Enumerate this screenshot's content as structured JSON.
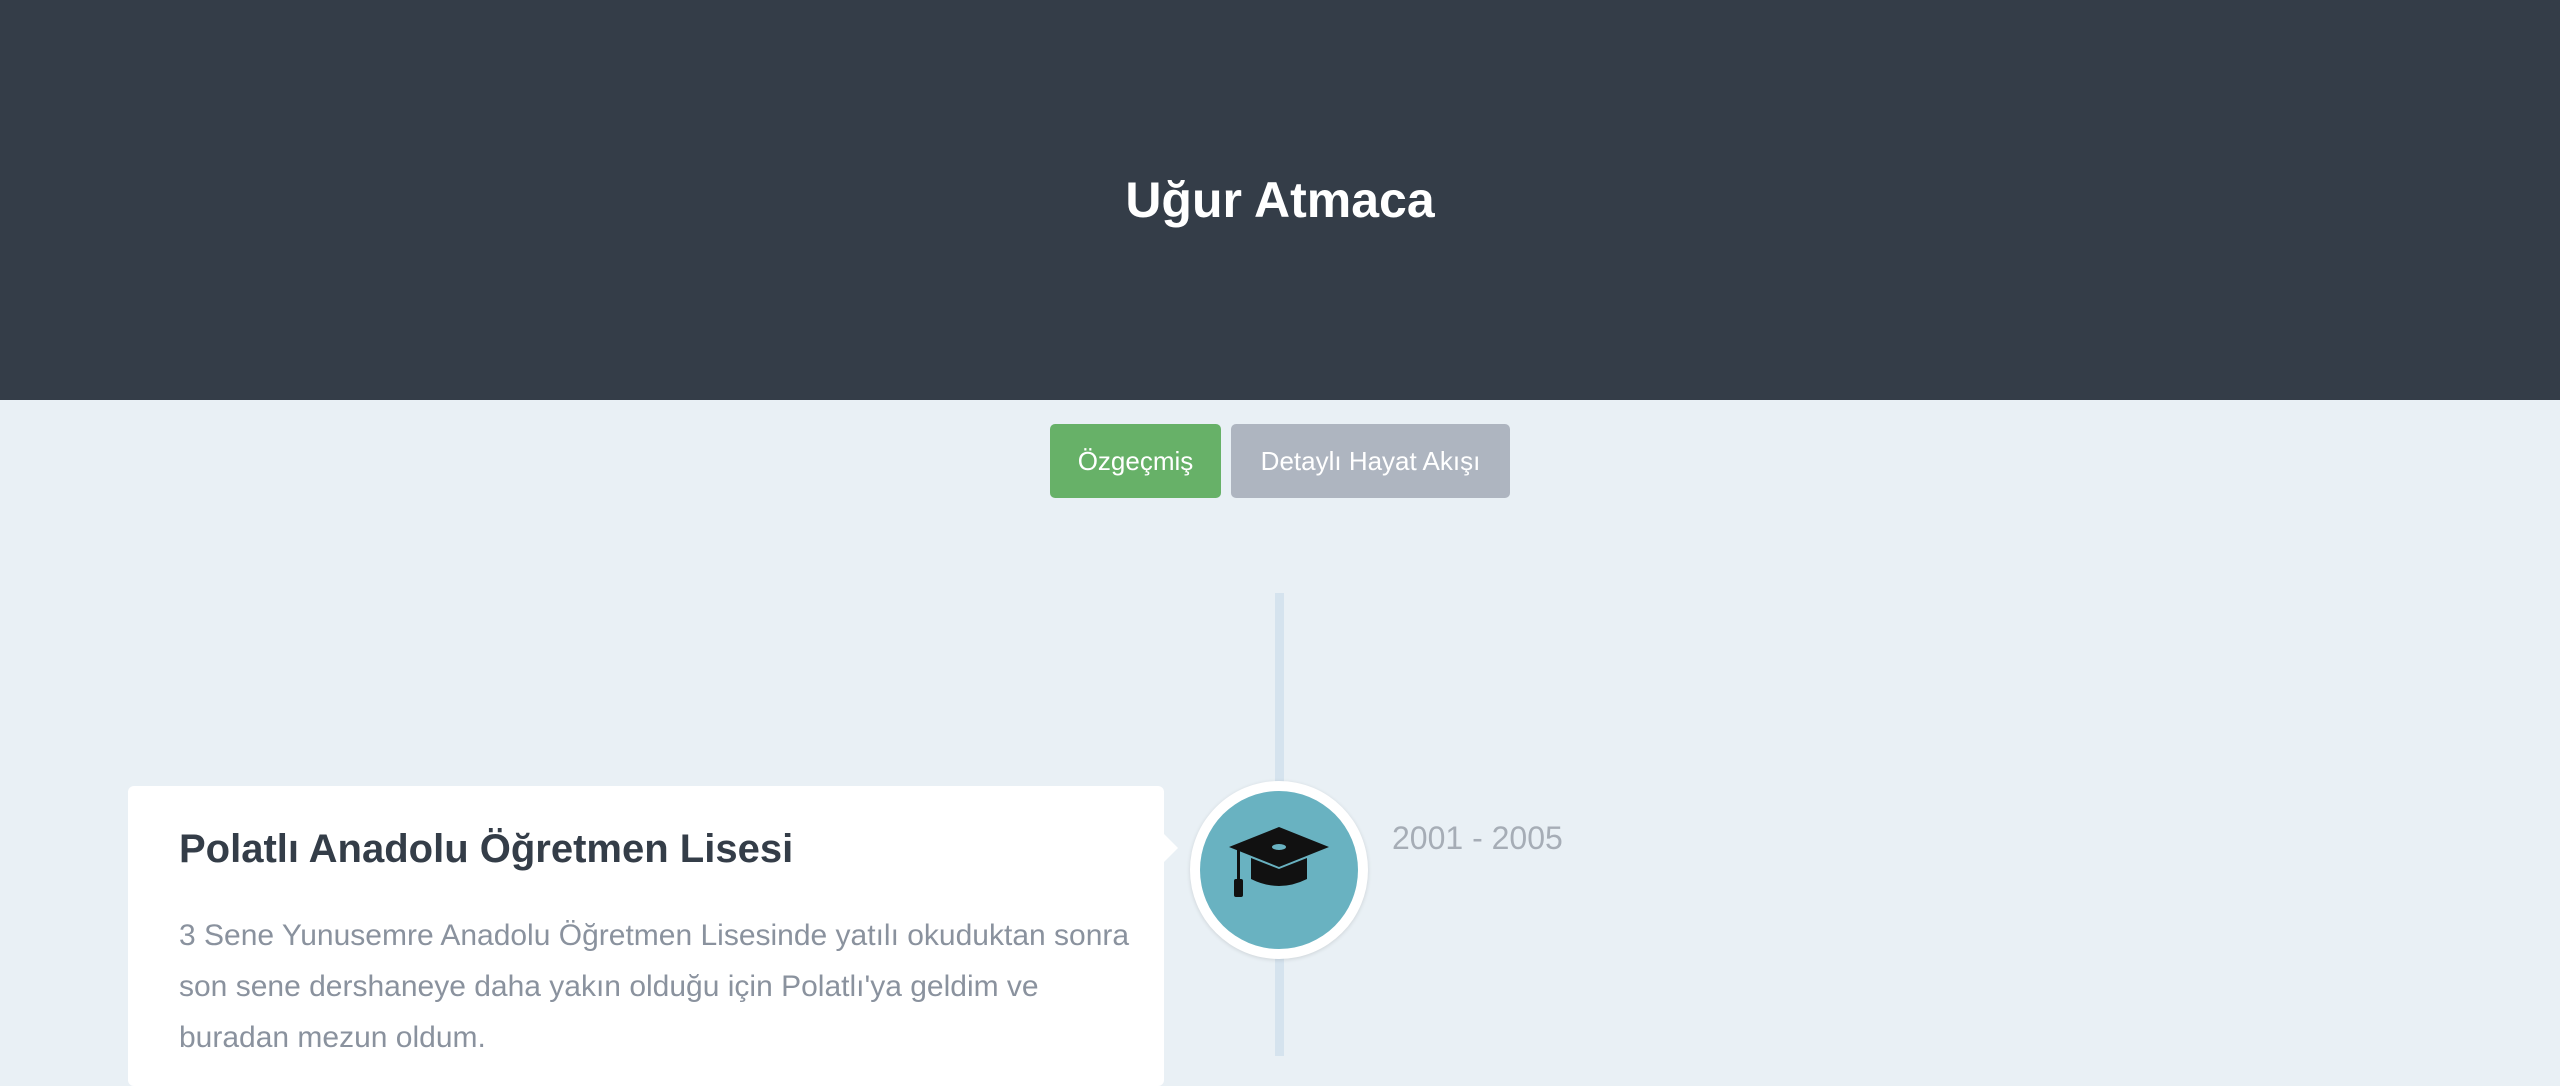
{
  "header": {
    "title": "Uğur Atmaca"
  },
  "nav": {
    "cv_label": "Özgeçmiş",
    "flow_label": "Detaylı Hayat Akışı"
  },
  "timeline": {
    "items": [
      {
        "title": "Polatlı Anadolu Öğretmen Lisesi",
        "description": "3 Sene Yunusemre Anadolu Öğretmen Lisesinde yatılı okuduktan sonra son sene dershaneye daha yakın olduğu için Polatlı'ya geldim ve buradan mezun oldum.",
        "date": "2001 - 2005",
        "icon": "graduation-cap-icon"
      }
    ]
  },
  "colors": {
    "header_bg": "#343d48",
    "page_bg": "#e9f0f5",
    "button_active": "#67b168",
    "button_inactive": "#aeb5c0",
    "icon_bg": "#69b2c1"
  }
}
